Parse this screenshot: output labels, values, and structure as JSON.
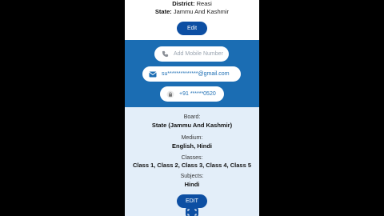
{
  "profile": {
    "district_label": "District:",
    "district_value": "Reasi",
    "state_label": "State:",
    "state_value": "Jammu And Kashmir",
    "edit_label": "Edit"
  },
  "contact": {
    "mobile_placeholder": "Add Mobile Number",
    "email_value": "su**************@gmail.com",
    "phone_value": "+91 ******0520",
    "icons": [
      "phone-icon",
      "mail-icon",
      "lock-icon"
    ]
  },
  "details": {
    "board_label": "Board:",
    "board_value": "State (Jammu And Kashmir)",
    "medium_label": "Medium:",
    "medium_value": "English, Hindi",
    "classes_label": "Classes:",
    "classes_value": "Class 1, Class 2, Class 3, Class 4, Class 5",
    "subjects_label": "Subjects:",
    "subjects_value": "Hindi",
    "edit_label": "EDIT"
  },
  "colors": {
    "primary": "#1b6db3",
    "button": "#0d4fa3",
    "light_bg": "#e3eef9"
  }
}
